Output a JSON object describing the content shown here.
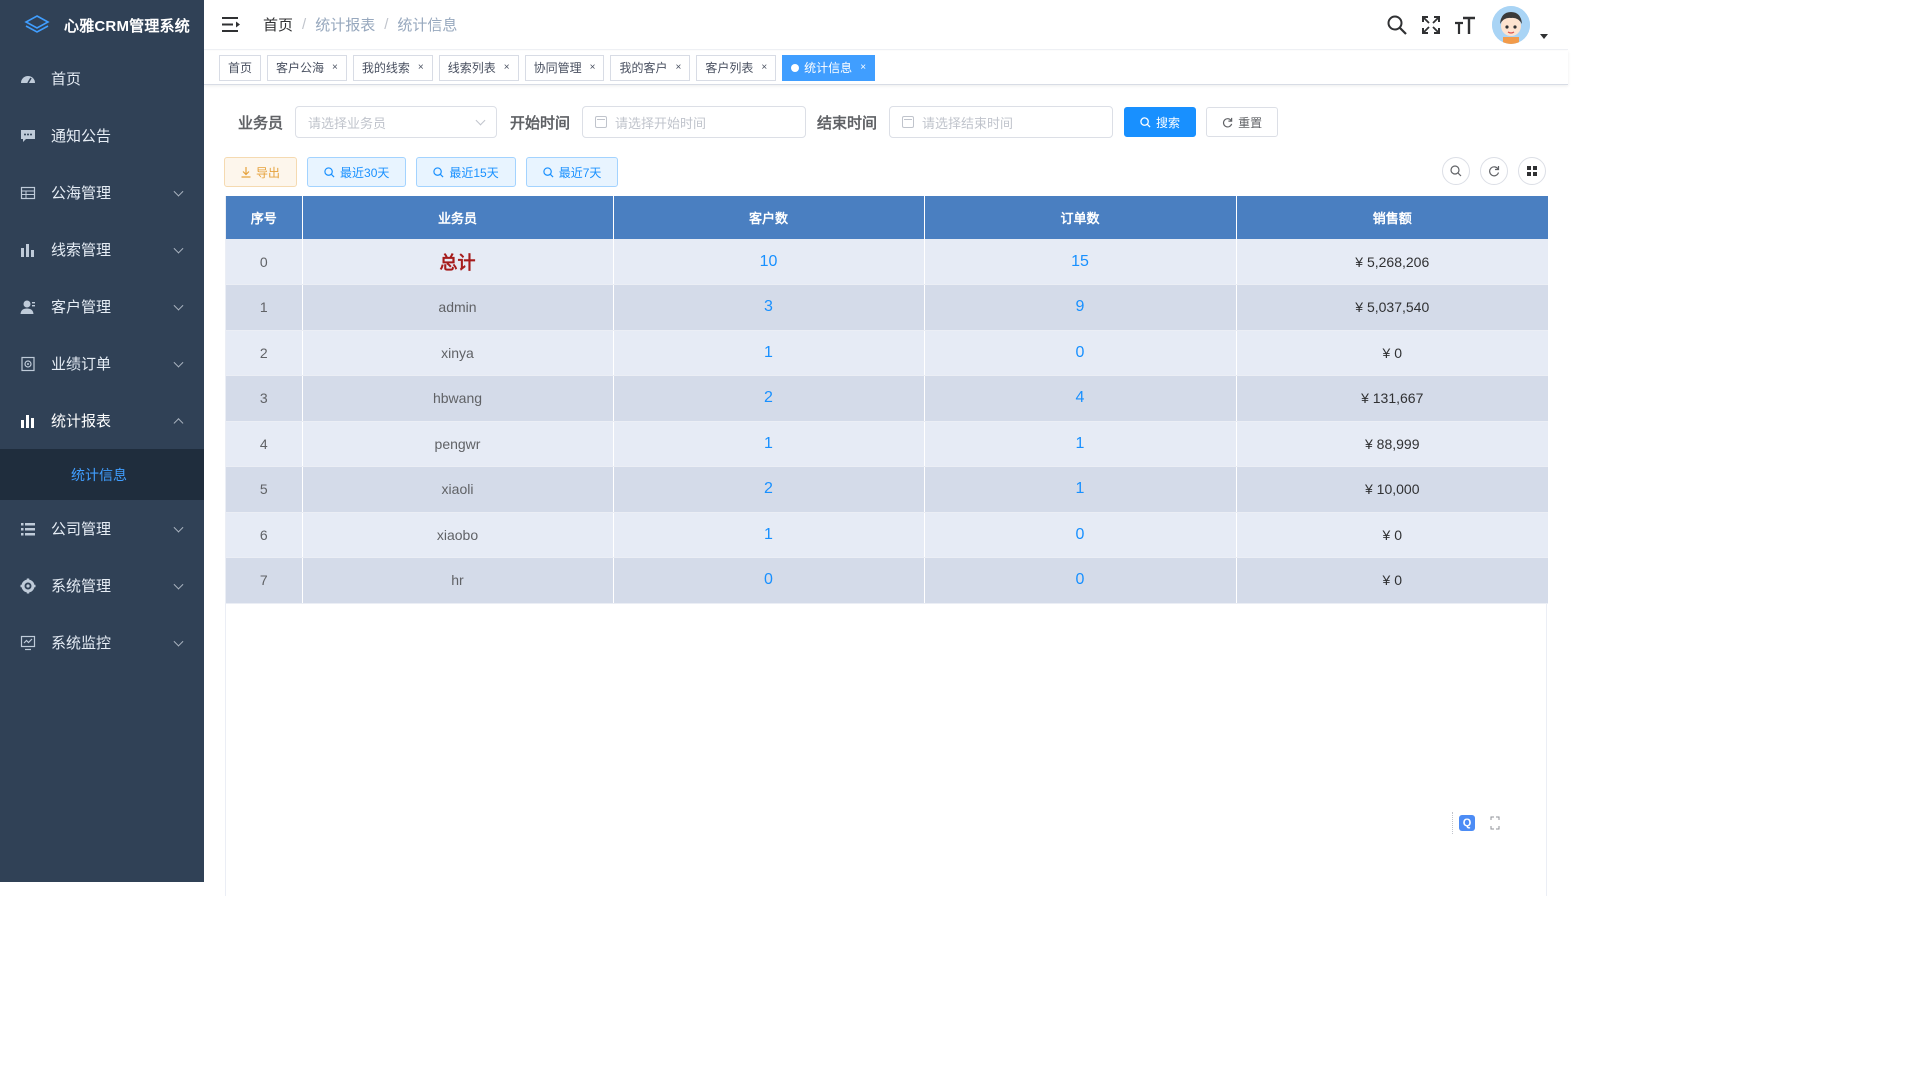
{
  "app": {
    "title": "心雅CRM管理系统"
  },
  "sidebar": {
    "items": [
      {
        "label": "首页",
        "icon": "dashboard-icon",
        "expandable": false
      },
      {
        "label": "通知公告",
        "icon": "message-icon",
        "expandable": false
      },
      {
        "label": "公海管理",
        "icon": "table-icon",
        "expandable": true
      },
      {
        "label": "线索管理",
        "icon": "bar-chart-icon",
        "expandable": true
      },
      {
        "label": "客户管理",
        "icon": "user-icon",
        "expandable": true
      },
      {
        "label": "业绩订单",
        "icon": "order-icon",
        "expandable": true
      },
      {
        "label": "统计报表",
        "icon": "chart-icon",
        "expandable": true,
        "expanded": true
      },
      {
        "label": "公司管理",
        "icon": "list-icon",
        "expandable": true
      },
      {
        "label": "系统管理",
        "icon": "gear-icon",
        "expandable": true
      },
      {
        "label": "系统监控",
        "icon": "monitor-icon",
        "expandable": true
      }
    ],
    "submenu_active": "统计信息"
  },
  "header": {
    "breadcrumb": [
      "首页",
      "统计报表",
      "统计信息"
    ],
    "separator": "/"
  },
  "tags": [
    {
      "label": "首页",
      "closable": false,
      "active": false
    },
    {
      "label": "客户公海",
      "closable": true,
      "active": false
    },
    {
      "label": "我的线索",
      "closable": true,
      "active": false
    },
    {
      "label": "线索列表",
      "closable": true,
      "active": false
    },
    {
      "label": "协同管理",
      "closable": true,
      "active": false
    },
    {
      "label": "我的客户",
      "closable": true,
      "active": false
    },
    {
      "label": "客户列表",
      "closable": true,
      "active": false
    },
    {
      "label": "统计信息",
      "closable": true,
      "active": true
    }
  ],
  "filters": {
    "salesperson_label": "业务员",
    "salesperson_placeholder": "请选择业务员",
    "start_label": "开始时间",
    "start_placeholder": "请选择开始时间",
    "end_label": "结束时间",
    "end_placeholder": "请选择结束时间",
    "search_label": "搜索",
    "reset_label": "重置"
  },
  "actions": {
    "export_label": "导出",
    "last30_label": "最近30天",
    "last15_label": "最近15天",
    "last7_label": "最近7天"
  },
  "table": {
    "columns": [
      "序号",
      "业务员",
      "客户数",
      "订单数",
      "销售额"
    ],
    "rows": [
      {
        "index": "0",
        "name": "总计",
        "customers": "10",
        "orders": "15",
        "sales": "¥ 5,268,206"
      },
      {
        "index": "1",
        "name": "admin",
        "customers": "3",
        "orders": "9",
        "sales": "¥ 5,037,540"
      },
      {
        "index": "2",
        "name": "xinya",
        "customers": "1",
        "orders": "0",
        "sales": "¥ 0"
      },
      {
        "index": "3",
        "name": "hbwang",
        "customers": "2",
        "orders": "4",
        "sales": "¥ 131,667"
      },
      {
        "index": "4",
        "name": "pengwr",
        "customers": "1",
        "orders": "1",
        "sales": "¥ 88,999"
      },
      {
        "index": "5",
        "name": "xiaoli",
        "customers": "2",
        "orders": "1",
        "sales": "¥ 10,000"
      },
      {
        "index": "6",
        "name": "xiaobo",
        "customers": "1",
        "orders": "0",
        "sales": "¥ 0"
      },
      {
        "index": "7",
        "name": "hr",
        "customers": "0",
        "orders": "0",
        "sales": "¥ 0"
      }
    ]
  },
  "colors": {
    "sidebar_bg": "#304156",
    "submenu_bg": "#1f2d3d",
    "primary": "#1890ff",
    "table_header": "#4a7fc1",
    "total_red": "#a61c1c"
  }
}
